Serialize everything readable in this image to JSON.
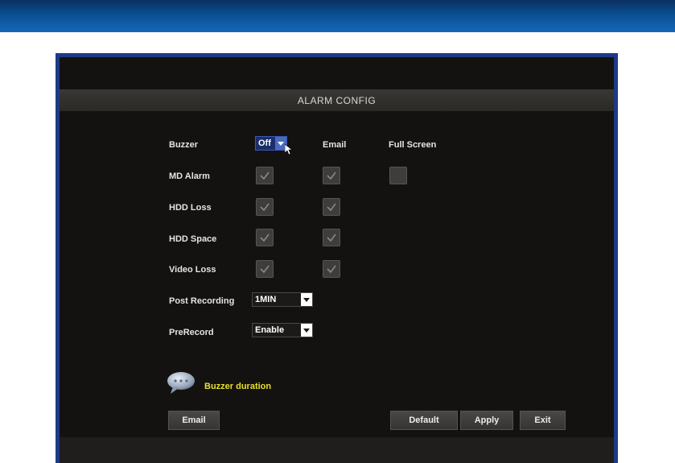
{
  "window": {
    "title": "ALARM CONFIG"
  },
  "columns": {
    "email": "Email",
    "full_screen": "Full Screen"
  },
  "buzzer": {
    "label": "Buzzer",
    "value": "Off"
  },
  "rows": [
    {
      "label": "MD Alarm",
      "buzzer": true,
      "email": true,
      "full_screen": false
    },
    {
      "label": "HDD Loss",
      "buzzer": true,
      "email": true
    },
    {
      "label": "HDD Space",
      "buzzer": true,
      "email": true
    },
    {
      "label": "Video Loss",
      "buzzer": true,
      "email": true
    }
  ],
  "post_recording": {
    "label": "Post Recording",
    "value": "1MIN"
  },
  "prerecord": {
    "label": "PreRecord",
    "value": "Enable"
  },
  "tip": {
    "text": "Buzzer duration",
    "icon": "speech-bubble-icon"
  },
  "buttons": {
    "email": "Email",
    "default": "Default",
    "apply": "Apply",
    "exit": "Exit"
  },
  "colors": {
    "frame": "#1e3a86",
    "banner": "#0b4f94",
    "tip_text": "#e6e02a",
    "background": "#141210"
  }
}
